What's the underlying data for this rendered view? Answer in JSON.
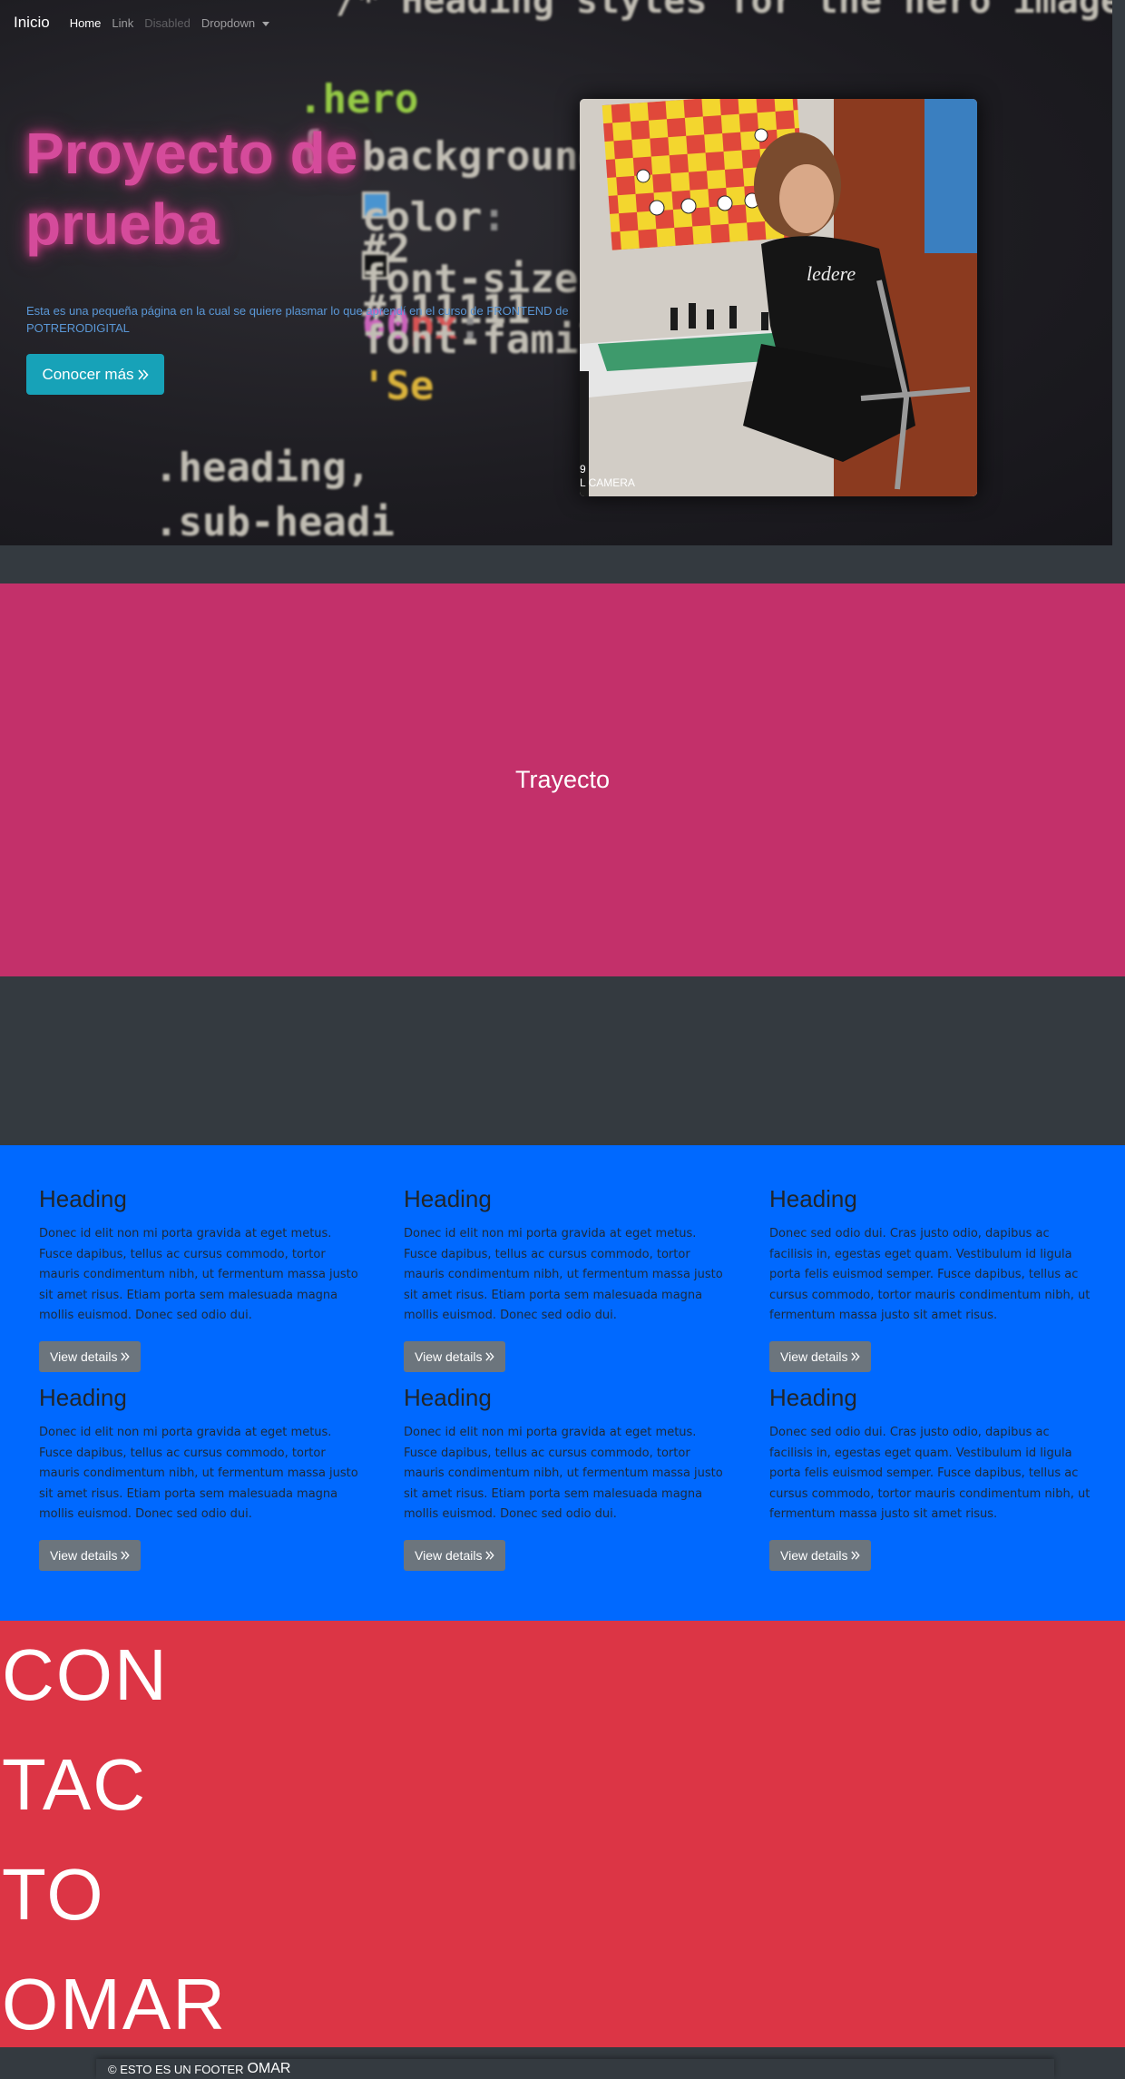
{
  "navbar": {
    "brand": "Inicio",
    "links": [
      {
        "label": "Home",
        "state": "active"
      },
      {
        "label": "Link",
        "state": "normal"
      },
      {
        "label": "Disabled",
        "state": "disabled"
      },
      {
        "label": "Dropdown",
        "state": "dropdown"
      }
    ]
  },
  "hero": {
    "title": "Proyecto de prueba",
    "description": "Esta es una pequeña página en la cual se quiere plasmar lo que aprendí en el curso de FRONTEND de POTRERODIGITAL",
    "cta_label": "Conocer más",
    "cta_icon": "double-chevron-right-icon",
    "code_bg": {
      "comment": "/* Heading styles for the hero image */",
      "selector": ".hero",
      "brace": "{",
      "line_background_prop": "background",
      "line_background_value": "#2",
      "line_color_prop": "color",
      "line_color_value": "#111111",
      "line_fontsize_prop": "font-size",
      "line_fontsize_num": "60",
      "line_fontsize_unit": "px",
      "line_fontfamily_prop": "font-family",
      "line_fontfamily_value": "'Se",
      "selector2": ".heading,",
      "selector3": ".sub-headi"
    },
    "photo": {
      "caption_line1": "9",
      "caption_line2": "L CAMERA"
    }
  },
  "trayecto": {
    "title": "Trayecto"
  },
  "cards": [
    {
      "heading": "Heading",
      "text": "Donec id elit non mi porta gravida at eget metus. Fusce dapibus, tellus ac cursus commodo, tortor mauris condimentum nibh, ut fermentum massa justo sit amet risus. Etiam porta sem malesuada magna mollis euismod. Donec sed odio dui.",
      "button": "View details"
    },
    {
      "heading": "Heading",
      "text": "Donec id elit non mi porta gravida at eget metus. Fusce dapibus, tellus ac cursus commodo, tortor mauris condimentum nibh, ut fermentum massa justo sit amet risus. Etiam porta sem malesuada magna mollis euismod. Donec sed odio dui.",
      "button": "View details"
    },
    {
      "heading": "Heading",
      "text": "Donec sed odio dui. Cras justo odio, dapibus ac facilisis in, egestas eget quam. Vestibulum id ligula porta felis euismod semper. Fusce dapibus, tellus ac cursus commodo, tortor mauris condimentum nibh, ut fermentum massa justo sit amet risus.",
      "button": "View details"
    },
    {
      "heading": "Heading",
      "text": "Donec id elit non mi porta gravida at eget metus. Fusce dapibus, tellus ac cursus commodo, tortor mauris condimentum nibh, ut fermentum massa justo sit amet risus. Etiam porta sem malesuada magna mollis euismod. Donec sed odio dui.",
      "button": "View details"
    },
    {
      "heading": "Heading",
      "text": "Donec id elit non mi porta gravida at eget metus. Fusce dapibus, tellus ac cursus commodo, tortor mauris condimentum nibh, ut fermentum massa justo sit amet risus. Etiam porta sem malesuada magna mollis euismod. Donec sed odio dui.",
      "button": "View details"
    },
    {
      "heading": "Heading",
      "text": "Donec sed odio dui. Cras justo odio, dapibus ac facilisis in, egestas eget quam. Vestibulum id ligula porta felis euismod semper. Fusce dapibus, tellus ac cursus commodo, tortor mauris condimentum nibh, ut fermentum massa justo sit amet risus.",
      "button": "View details"
    }
  ],
  "contact": {
    "lines": [
      "CON",
      "TAC",
      "TO",
      "OMAR"
    ]
  },
  "footer": {
    "text": "© ESTO ES UN FOOTER",
    "owner": "OMAR"
  },
  "colors": {
    "page_bg": "#343a40",
    "hero_title": "#d54b9b",
    "cta": "#17a2b8",
    "trayecto_bg": "#c3306a",
    "cards_bg": "#0069ff",
    "detail_button": "#6c757d",
    "contact_bg": "#dc3545"
  }
}
